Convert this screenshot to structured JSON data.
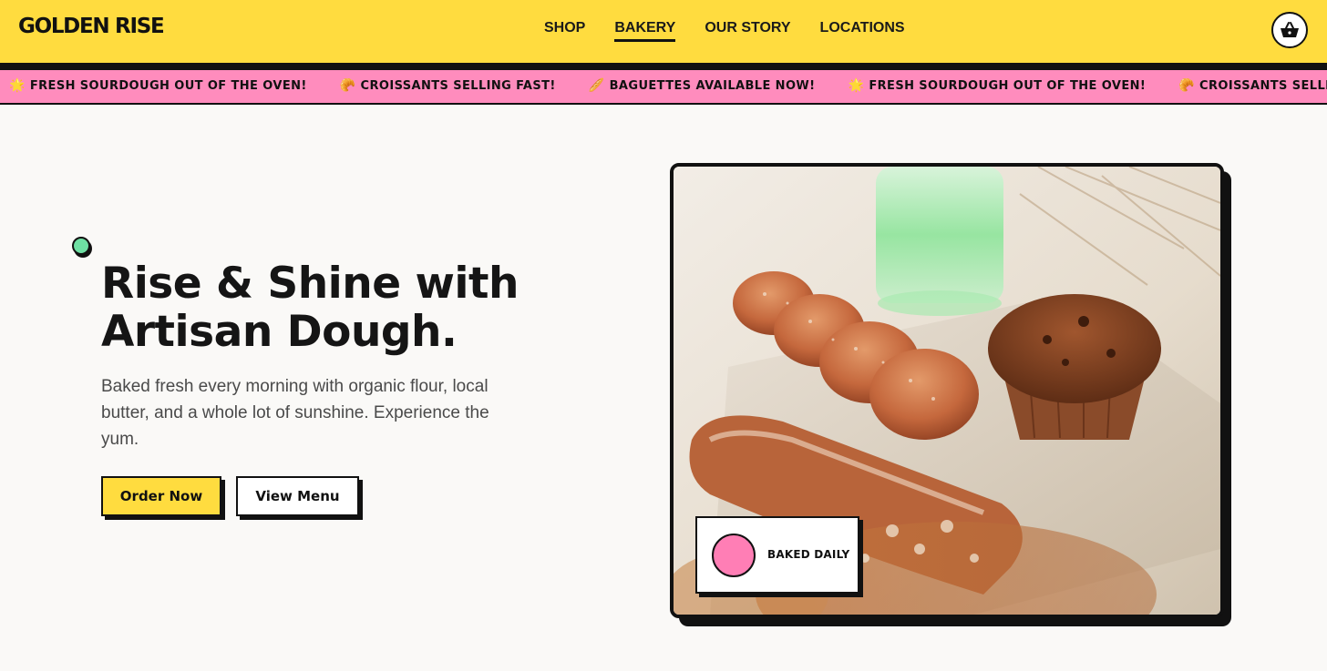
{
  "header": {
    "logo": "GOLDEN RISE",
    "nav": [
      {
        "label": "SHOP"
      },
      {
        "label": "BAKERY"
      },
      {
        "label": "OUR STORY"
      },
      {
        "label": "LOCATIONS"
      }
    ],
    "active_nav": "BAKERY",
    "cart_icon": "basket-icon"
  },
  "ticker": {
    "items": [
      {
        "emoji": "🌟",
        "text": "FRESH SOURDOUGH OUT OF THE OVEN!"
      },
      {
        "emoji": "🥐",
        "text": "CROISSANTS SELLING FAST!"
      },
      {
        "emoji": "🥖",
        "text": "BAGUETTES AVAILABLE NOW!"
      },
      {
        "emoji": "🌟",
        "text": "FRESH SOURDOUGH OUT OF THE OVEN!"
      },
      {
        "emoji": "🥐",
        "text": "CROISSANTS SELLING FAST!"
      }
    ]
  },
  "hero": {
    "headline": "Rise & Shine with Artisan Dough.",
    "subcopy": "Baked fresh every morning with organic flour, local butter, and a whole lot of sunshine. Experience the yum.",
    "primary_button": "Order Now",
    "secondary_button": "View Menu",
    "badge": "BAKED DAILY"
  },
  "colors": {
    "brand_yellow": "#FFDC3F",
    "ticker_pink": "#FF8CBD",
    "badge_pink": "#FF7EB5",
    "accent_mint": "#6EE0A3",
    "ink": "#111111",
    "background": "#FAF9F7"
  }
}
